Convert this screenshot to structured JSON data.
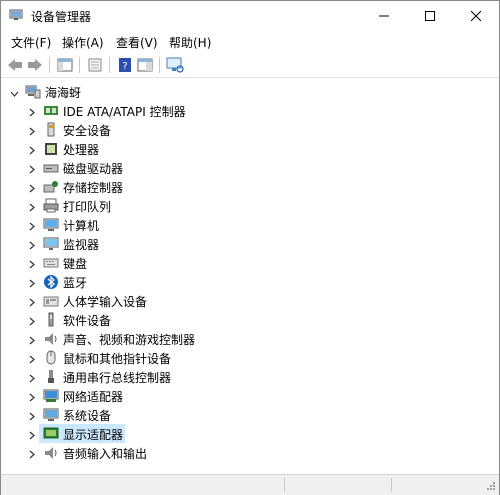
{
  "window": {
    "title": "设备管理器"
  },
  "menu": {
    "file": "文件(F)",
    "action": "操作(A)",
    "view": "查看(V)",
    "help": "帮助(H)"
  },
  "toolbar": {
    "buttons": [
      "back-icon",
      "forward-icon",
      "show-hide-tree-icon",
      "properties-icon",
      "help-icon",
      "action-pane-icon",
      "scan-hardware-icon"
    ]
  },
  "tree": {
    "root_label": "海海蚜",
    "items": [
      {
        "label": "IDE ATA/ATAPI 控制器",
        "icon": "ide-controller-icon"
      },
      {
        "label": "安全设备",
        "icon": "security-device-icon"
      },
      {
        "label": "处理器",
        "icon": "processor-icon"
      },
      {
        "label": "磁盘驱动器",
        "icon": "disk-drive-icon"
      },
      {
        "label": "存储控制器",
        "icon": "storage-controller-icon"
      },
      {
        "label": "打印队列",
        "icon": "printer-icon"
      },
      {
        "label": "计算机",
        "icon": "computer-icon"
      },
      {
        "label": "监视器",
        "icon": "monitor-icon"
      },
      {
        "label": "键盘",
        "icon": "keyboard-icon"
      },
      {
        "label": "蓝牙",
        "icon": "bluetooth-icon"
      },
      {
        "label": "人体学输入设备",
        "icon": "hid-icon"
      },
      {
        "label": "软件设备",
        "icon": "software-device-icon"
      },
      {
        "label": "声音、视频和游戏控制器",
        "icon": "sound-icon"
      },
      {
        "label": "鼠标和其他指针设备",
        "icon": "mouse-icon"
      },
      {
        "label": "通用串行总线控制器",
        "icon": "usb-icon"
      },
      {
        "label": "网络适配器",
        "icon": "network-adapter-icon"
      },
      {
        "label": "系统设备",
        "icon": "system-device-icon"
      },
      {
        "label": "显示适配器",
        "icon": "display-adapter-icon",
        "selected": true
      },
      {
        "label": "音频输入和输出",
        "icon": "audio-io-icon"
      }
    ]
  },
  "colors": {
    "selection": "#cce8ff",
    "accent": "#1a7fd4"
  }
}
